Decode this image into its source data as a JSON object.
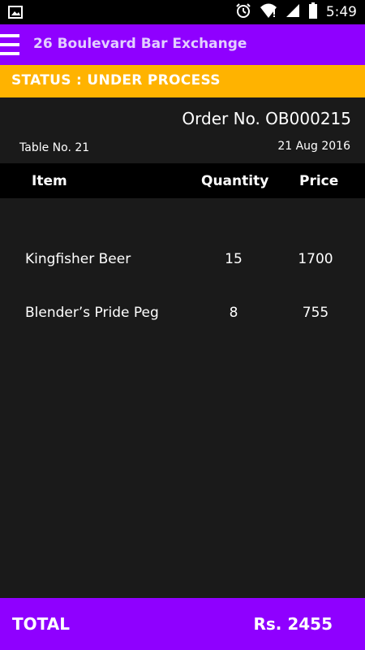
{
  "status_bar": {
    "time": "5:49",
    "icons": [
      "image-icon",
      "alarm-icon",
      "wifi-icon",
      "signal-icon",
      "battery-icon"
    ]
  },
  "app_bar": {
    "title": "26 Boulevard Bar Exchange",
    "menu_icon": "hamburger-menu-icon"
  },
  "status": {
    "text": "STATUS : UNDER PROCESS"
  },
  "order": {
    "order_no": "Order No. OB000215",
    "table_no": "Table No. 21",
    "date": "21 Aug 2016"
  },
  "table": {
    "headers": {
      "item": "Item",
      "quantity": "Quantity",
      "price": "Price"
    },
    "rows": [
      {
        "item": "Kingfisher Beer",
        "quantity": "15",
        "price": "1700"
      },
      {
        "item": "Blender’s Pride Peg",
        "quantity": "8",
        "price": "755"
      }
    ]
  },
  "footer": {
    "total_label": "TOTAL",
    "total_value": "Rs. 2455"
  },
  "colors": {
    "app_bar": "#8f00ff",
    "status_banner": "#ffb300",
    "background": "#1a1a1a",
    "header_bg": "#000000"
  }
}
